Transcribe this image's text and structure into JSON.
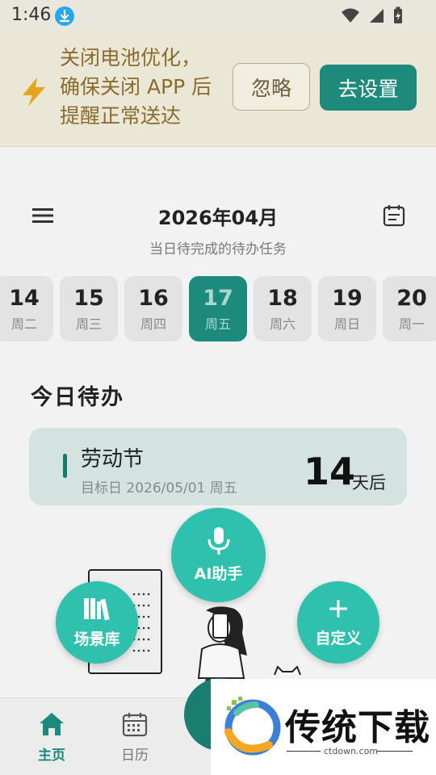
{
  "status_bar": {
    "time": "1:46",
    "icons": [
      "download-icon",
      "wifi-icon",
      "signal-icon",
      "battery-charging-icon"
    ]
  },
  "banner": {
    "icon": "lightning-icon",
    "lines": [
      "关闭电池优化，",
      "确保关闭 APP 后",
      "提醒正常送达"
    ],
    "ignore_label": "忽略",
    "settings_label": "去设置"
  },
  "header": {
    "month": "2026年04月",
    "subtitle": "当日待完成的待办任务"
  },
  "date_strip": [
    {
      "day": "14",
      "weekday": "周二",
      "selected": false
    },
    {
      "day": "15",
      "weekday": "周三",
      "selected": false
    },
    {
      "day": "16",
      "weekday": "周四",
      "selected": false
    },
    {
      "day": "17",
      "weekday": "周五",
      "selected": true
    },
    {
      "day": "18",
      "weekday": "周六",
      "selected": false
    },
    {
      "day": "19",
      "weekday": "周日",
      "selected": false
    },
    {
      "day": "20",
      "weekday": "周一",
      "selected": false
    }
  ],
  "today_section": {
    "title": "今日待办",
    "event": {
      "name": "劳动节",
      "target": "目标日 2026/05/01 周五",
      "days": "14",
      "unit": "天后"
    }
  },
  "fabs": {
    "ai": "AI助手",
    "scene": "场景库",
    "custom": "自定义"
  },
  "bottom_nav": {
    "home": "主页",
    "calendar": "日历"
  },
  "watermark": {
    "text": "传统下载",
    "url": "ctdown.com"
  },
  "colors": {
    "primary": "#1c8a7c",
    "fab": "#2fc1ad",
    "banner_text": "#8a6c2e"
  }
}
